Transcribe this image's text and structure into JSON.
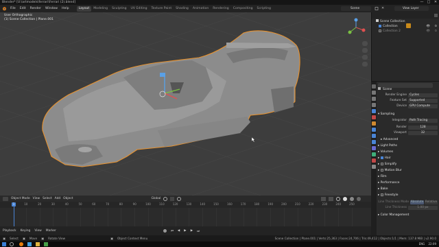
{
  "window": {
    "title": "Blender* [U:\\artmodels\\ferrari\\Ferrari (2).blend]",
    "controls": [
      "—",
      "□",
      "✕"
    ]
  },
  "menubar": {
    "items": [
      "File",
      "Edit",
      "Render",
      "Window",
      "Help"
    ],
    "workspaces": [
      "Layout",
      "Modeling",
      "Sculpting",
      "UV Editing",
      "Texture Paint",
      "Shading",
      "Animation",
      "Rendering",
      "Compositing",
      "Scripting"
    ],
    "scene": "Scene",
    "view_layer": "View Layer"
  },
  "viewport": {
    "view_name": "User Orthographic",
    "collection_info": "(1) Scene Collection | Plane.001"
  },
  "header": {
    "mode": "Object Mode",
    "items": [
      "View",
      "Select",
      "Add",
      "Object"
    ],
    "orientation": "Global"
  },
  "timeline": {
    "ticks": [
      "1",
      "10",
      "20",
      "30",
      "40",
      "50",
      "60",
      "70",
      "80",
      "90",
      "100",
      "110",
      "120",
      "130",
      "140",
      "150",
      "160",
      "170",
      "180",
      "190",
      "200",
      "210",
      "220",
      "230",
      "240",
      "250"
    ],
    "current_frame": "1",
    "playback": "Playback",
    "keying": "Keying",
    "view": "View",
    "marker": "Marker",
    "start_label": "Start",
    "start": "1",
    "end_label": "End",
    "end": "250"
  },
  "outliner": {
    "rows": [
      {
        "name": "Scene Collection"
      },
      {
        "name": "Collection"
      },
      {
        "name": "Collection 2"
      }
    ]
  },
  "properties": {
    "tabs": [
      "tool",
      "render",
      "output",
      "view-layer",
      "scene",
      "world",
      "object",
      "modifiers",
      "particles",
      "physics",
      "constraints",
      "data",
      "material",
      "texture"
    ],
    "scene_name": "Scene",
    "render_engine_label": "Render Engine",
    "render_engine": "Cycles",
    "feature_set_label": "Feature Set",
    "feature_set": "Supported",
    "device_label": "Device",
    "device": "GPU Compute",
    "sampling": "Sampling",
    "integrator_label": "Integrator",
    "integrator": "Path Tracing",
    "render_label": "Render",
    "render_samples": "128",
    "viewport_label": "Viewport",
    "viewport_samples": "32",
    "advanced": "Advanced",
    "light_paths": "Light Paths",
    "volumes": "Volumes",
    "hair": "Hair",
    "simplify": "Simplify",
    "motion_blur": "Motion Blur",
    "film": "Film",
    "performance": "Performance",
    "bake": "Bake",
    "freestyle": "Freestyle",
    "line_thickness_mode": "Line Thickness Mode",
    "absolute": "Absolute",
    "relative": "Relative",
    "line_thickness": "Line Thickness",
    "line_thickness_val": "1.00 px",
    "color_management": "Color Management"
  },
  "statusbar": {
    "items": [
      "Select",
      "Move",
      "Rotate View",
      "Object Context Menu"
    ],
    "stats": "Scene Collection | Plane.001 | Verts:25,363 | Faces:24,706 | Tris:49,412 | Objects:1/1 | Mem: 137.8 MiB | v2.90.0"
  },
  "taskbar": {
    "lang": "ENG",
    "time": "22:09"
  },
  "colors": {
    "accent": "#4a85d6",
    "selection_outline": "#e8922e",
    "viewport_bg": "#3d3d3d"
  }
}
